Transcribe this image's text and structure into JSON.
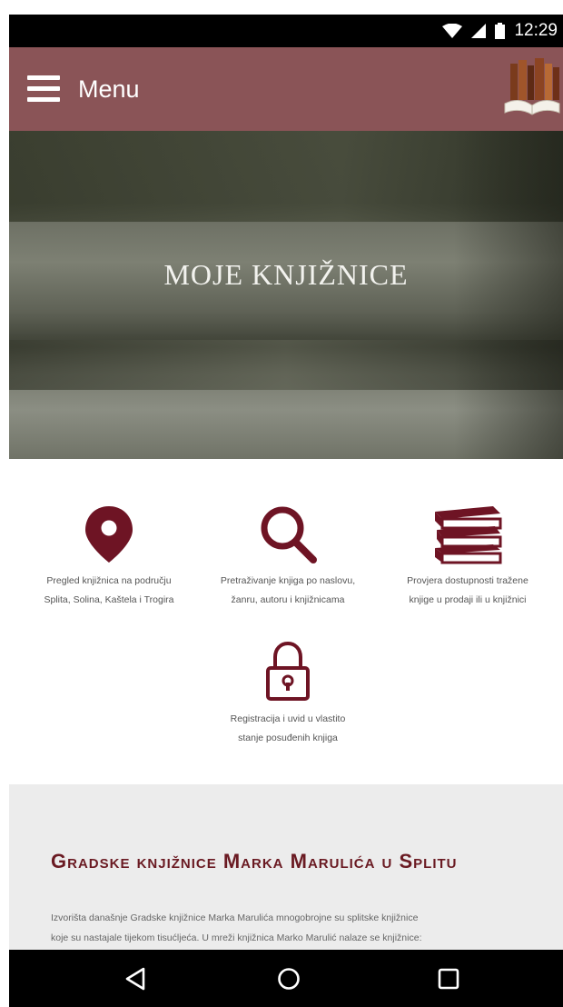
{
  "status_bar": {
    "time": "12:29",
    "icons": [
      "wifi-icon",
      "signal-icon",
      "battery-icon"
    ]
  },
  "app_bar": {
    "menu_label": "Menu",
    "menu_icon": "hamburger-icon",
    "logo": "books-logo"
  },
  "hero": {
    "title": "MOJE KNJIŽNICE"
  },
  "features": [
    {
      "icon": "map-pin-icon",
      "caption_line1": "Pregled knjižnica na području",
      "caption_line2": "Splita, Solina, Kaštela i Trogira"
    },
    {
      "icon": "search-icon",
      "caption_line1": "Pretraživanje knjiga po naslovu,",
      "caption_line2": "žanru, autoru i knjižnicama"
    },
    {
      "icon": "books-icon",
      "caption_line1": "Provjera dostupnosti tražene",
      "caption_line2": "knjige u prodaji ili u knjižnici"
    },
    {
      "icon": "lock-icon",
      "caption_line1": "Registracija i uvid u vlastito",
      "caption_line2": "stanje posuđenih knjiga"
    }
  ],
  "about": {
    "title": "Gradske knjižnice Marka Marulića u Splitu",
    "text_line1": "Izvorišta današnje Gradske knjižnice Marka Marulića mnogobrojne su splitske knjižnice",
    "text_line2": "koje su nastajale tijekom tisućljeća. U mreži knjižnica Marko Marulić nalaze se knjižnice:"
  },
  "nav_bar": {
    "buttons": [
      "back-icon",
      "home-icon",
      "recents-icon"
    ]
  },
  "colors": {
    "app_bar": "#8a5457",
    "accent": "#6e1424",
    "status_bar": "#000000",
    "about_bg": "#ececec"
  }
}
